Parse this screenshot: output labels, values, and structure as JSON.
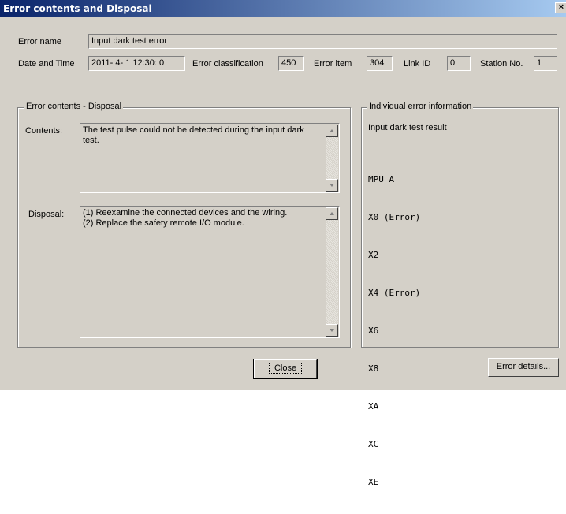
{
  "window": {
    "title": "Error contents and Disposal",
    "close_glyph": "×"
  },
  "header": {
    "error_name_label": "Error name",
    "error_name_value": "Input dark test error",
    "date_time_label": "Date and Time",
    "date_time_value": "2011- 4- 1 12:30: 0",
    "error_classification_label": "Error classification",
    "error_classification_value": "450",
    "error_item_label": "Error item",
    "error_item_value": "304",
    "link_id_label": "Link ID",
    "link_id_value": "0",
    "station_no_label": "Station No.",
    "station_no_value": "1"
  },
  "contents_group": {
    "title": "Error contents - Disposal",
    "contents_label": "Contents:",
    "contents_text": "The test pulse could not be detected during the input dark\ntest.",
    "disposal_label": "Disposal:",
    "disposal_text": "(1) Reexamine the connected devices and the wiring.\n(2) Replace the safety remote I/O module."
  },
  "individual_group": {
    "title": "Individual error information",
    "result_label": "Input dark test result",
    "lines": [
      "MPU A",
      "X0 (Error)",
      "X2",
      "X4 (Error)",
      "X6",
      "X8",
      "XA",
      "XC",
      "XE"
    ]
  },
  "buttons": {
    "close": "Close",
    "error_details": "Error details..."
  }
}
